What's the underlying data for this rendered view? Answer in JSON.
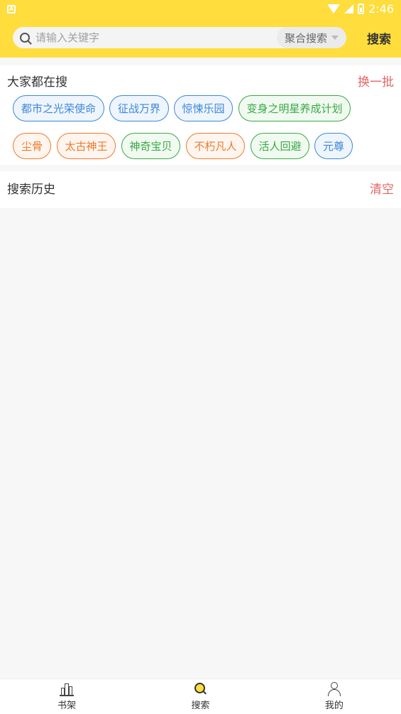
{
  "status_bar": {
    "time": "2:46",
    "notification_glyph": "A"
  },
  "search": {
    "placeholder": "请输入关键字",
    "mode": "聚合搜索",
    "button": "搜索"
  },
  "hot": {
    "title": "大家都在搜",
    "action": "换一批",
    "chips": [
      {
        "label": "都市之光荣使命",
        "color": "blue"
      },
      {
        "label": "征战万界",
        "color": "blue"
      },
      {
        "label": "惊悚乐园",
        "color": "blue"
      },
      {
        "label": "变身之明星养成计划",
        "color": "green"
      },
      {
        "label": "尘骨",
        "color": "orange"
      },
      {
        "label": "太古神王",
        "color": "orange"
      },
      {
        "label": "神奇宝贝",
        "color": "green"
      },
      {
        "label": "不朽凡人",
        "color": "orange"
      },
      {
        "label": "活人回避",
        "color": "green"
      },
      {
        "label": "元尊",
        "color": "blue"
      }
    ]
  },
  "history": {
    "title": "搜索历史",
    "action": "清空"
  },
  "nav": {
    "shelf": "书架",
    "search": "搜索",
    "mine": "我的"
  },
  "colors": {
    "accent": "#fedd3d",
    "action_red": "#e56565",
    "blue": "#3d87d8",
    "orange": "#ee7a2d",
    "green": "#39a845"
  }
}
